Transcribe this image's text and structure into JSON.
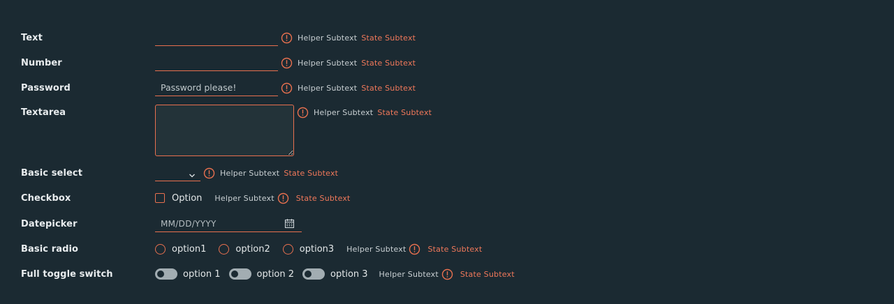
{
  "helper_text": "Helper Subtext",
  "state_text": "State Subtext",
  "colors": {
    "background": "#1b2a32",
    "error": "#e8704f",
    "label": "#e8ecee"
  },
  "icons": {
    "error": "exclamation-circle-icon",
    "select": "chevron-down-icon",
    "datepicker": "calendar-icon"
  },
  "fields": {
    "text": {
      "label": "Text",
      "value": ""
    },
    "number": {
      "label": "Number",
      "value": ""
    },
    "password": {
      "label": "Password",
      "placeholder": "Password please!",
      "value": ""
    },
    "textarea": {
      "label": "Textarea",
      "value": ""
    },
    "select": {
      "label": "Basic select",
      "value": ""
    },
    "checkbox": {
      "label": "Checkbox",
      "option": "Option",
      "checked": false
    },
    "datepicker": {
      "label": "Datepicker",
      "placeholder": "MM/DD/YYYY"
    },
    "radio": {
      "label": "Basic radio",
      "options": [
        "option1",
        "option2",
        "option3"
      ]
    },
    "toggle": {
      "label": "Full toggle switch",
      "options": [
        "option 1",
        "option 2",
        "option 3"
      ]
    }
  }
}
